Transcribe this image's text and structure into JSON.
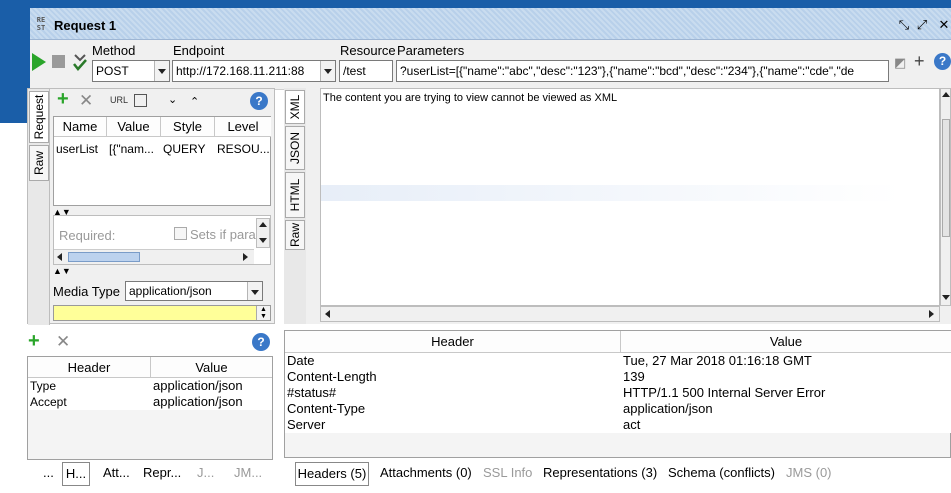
{
  "window": {
    "title": "Request 1",
    "icon_text": "RE ST"
  },
  "toolbar": {
    "method_label": "Method",
    "method_value": "POST",
    "endpoint_label": "Endpoint",
    "endpoint_value": "http://172.168.11.211:88",
    "resource_label": "Resource",
    "resource_value": "/test",
    "parameters_label": "Parameters",
    "parameters_value": "?userList=[{\"name\":\"abc\",\"desc\":\"123\"},{\"name\":\"bcd\",\"desc\":\"234\"},{\"name\":\"cde\",\"de"
  },
  "request_panel": {
    "tabs": [
      "Request",
      "Raw"
    ],
    "params_table": {
      "headers": [
        "Name",
        "Value",
        "Style",
        "Level"
      ],
      "rows": [
        {
          "name": "userList",
          "value": "[{\"nam...",
          "style": "QUERY",
          "level": "RESOU..."
        }
      ]
    },
    "required_label": "Required:",
    "sets_if_label": "Sets if para",
    "media_type_label": "Media Type",
    "media_type_value": "application/json"
  },
  "request_headers": {
    "headers": [
      "Header",
      "Value"
    ],
    "rows": [
      {
        "header": "Type",
        "value": "application/json"
      },
      {
        "header": "Accept",
        "value": "application/json"
      }
    ],
    "bottom_tabs": [
      "...",
      "H...",
      "Att...",
      "Repr...",
      "J...",
      "JM..."
    ]
  },
  "response_view": {
    "tabs": [
      "XML",
      "JSON",
      "HTML",
      "Raw"
    ],
    "message": "The content you are trying to view cannot be viewed as XML"
  },
  "response_headers": {
    "headers": [
      "Header",
      "Value"
    ],
    "rows": [
      {
        "header": "Date",
        "value": "Tue, 27 Mar 2018 01:16:18 GMT"
      },
      {
        "header": "Content-Length",
        "value": "139"
      },
      {
        "header": "#status#",
        "value": "HTTP/1.1 500 Internal Server Error"
      },
      {
        "header": "Content-Type",
        "value": "application/json"
      },
      {
        "header": "Server",
        "value": "act"
      }
    ],
    "bottom_tabs": [
      "Headers (5)",
      "Attachments (0)",
      "SSL Info",
      "Representations (3)",
      "Schema (conflicts)",
      "JMS (0)"
    ]
  },
  "colors": {
    "titlebar_accent": "#1a5ea8",
    "media_type_highlight": "#ffff99",
    "play_green": "#2aa52a"
  }
}
